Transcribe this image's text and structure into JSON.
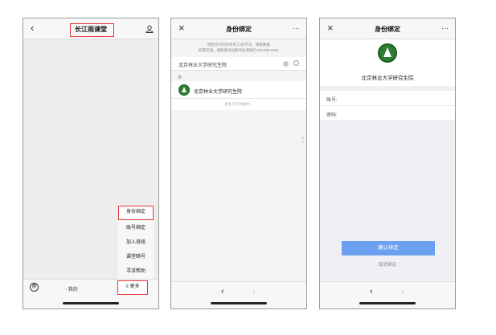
{
  "screen1": {
    "title": "长江雨课堂",
    "back_icon": "‹",
    "user_icon": "user-icon",
    "menu": [
      {
        "label": "身份绑定",
        "highlighted": true
      },
      {
        "label": "账号绑定",
        "highlighted": false
      },
      {
        "label": "加入班级",
        "highlighted": false
      },
      {
        "label": "课堂暗号",
        "highlighted": false
      },
      {
        "label": "寻求帮助",
        "highlighted": false
      }
    ],
    "tab_icon_glyph": "雨",
    "tab_me": "◦ 我的",
    "tab_more": "≡ 更多",
    "highlight_color": "#e53935"
  },
  "screen2": {
    "title": "身份绑定",
    "close_icon": "×",
    "more_icon": "···",
    "notice": "绑定后可同步校内工号/学号、课程数据\n如需开通，请联系校园教务处或拨打400-099-6061",
    "search_value": "北京林业大学研究生院",
    "index_letter": "B",
    "school_name": "北京林业大学研究生院",
    "more_schools": "更多学校添加中...",
    "index_letters": [
      "B",
      "#"
    ],
    "back_arrow": "‹",
    "forward_arrow": "›"
  },
  "screen3": {
    "title": "身份绑定",
    "close_icon": "×",
    "more_icon": "···",
    "school_name": "北京林业大学研究生院",
    "account_label": "账号:",
    "password_label": "密码:",
    "confirm_label": "确认绑定",
    "cancel_label": "取消绑定",
    "back_arrow": "‹",
    "forward_arrow": "›",
    "button_color": "#6aa0ef"
  }
}
